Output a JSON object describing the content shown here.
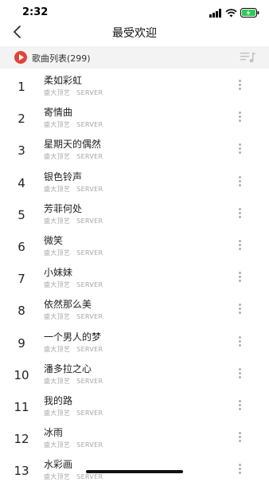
{
  "status_bar": {
    "time": "2:32"
  },
  "nav": {
    "title": "最受欢迎"
  },
  "list_header": {
    "label": "歌曲列表(299)"
  },
  "songs": [
    {
      "index": "1",
      "title": "柔如彩虹",
      "artist": "盛大顶艺",
      "source": "SERVER"
    },
    {
      "index": "2",
      "title": "寄情曲",
      "artist": "盛大顶艺",
      "source": "SERVER"
    },
    {
      "index": "3",
      "title": "星期天的偶然",
      "artist": "盛大顶艺",
      "source": "SERVER"
    },
    {
      "index": "4",
      "title": "银色铃声",
      "artist": "盛大顶艺",
      "source": "SERVER"
    },
    {
      "index": "5",
      "title": "芳菲何处",
      "artist": "盛大顶艺",
      "source": "SERVER"
    },
    {
      "index": "6",
      "title": "微笑",
      "artist": "盛大顶艺",
      "source": "SERVER"
    },
    {
      "index": "7",
      "title": "小妹妹",
      "artist": "盛大顶艺",
      "source": "SERVER"
    },
    {
      "index": "8",
      "title": "依然那么美",
      "artist": "盛大顶艺",
      "source": "SERVER"
    },
    {
      "index": "9",
      "title": "一个男人的梦",
      "artist": "盛大顶艺",
      "source": "SERVER"
    },
    {
      "index": "10",
      "title": "潘多拉之心",
      "artist": "盛大顶艺",
      "source": "SERVER"
    },
    {
      "index": "11",
      "title": "我的路",
      "artist": "盛大顶艺",
      "source": "SERVER"
    },
    {
      "index": "12",
      "title": "冰雨",
      "artist": "盛大顶艺",
      "source": "SERVER"
    },
    {
      "index": "13",
      "title": "水彩画",
      "artist": "盛大顶艺",
      "source": "SERVER"
    }
  ],
  "icons": {
    "back": "chevron-left-icon",
    "play": "play-circle-icon",
    "playlist": "playlist-icon",
    "more": "more-vertical-icon"
  },
  "colors": {
    "accent": "#e0443a",
    "battery": "#34c759"
  }
}
